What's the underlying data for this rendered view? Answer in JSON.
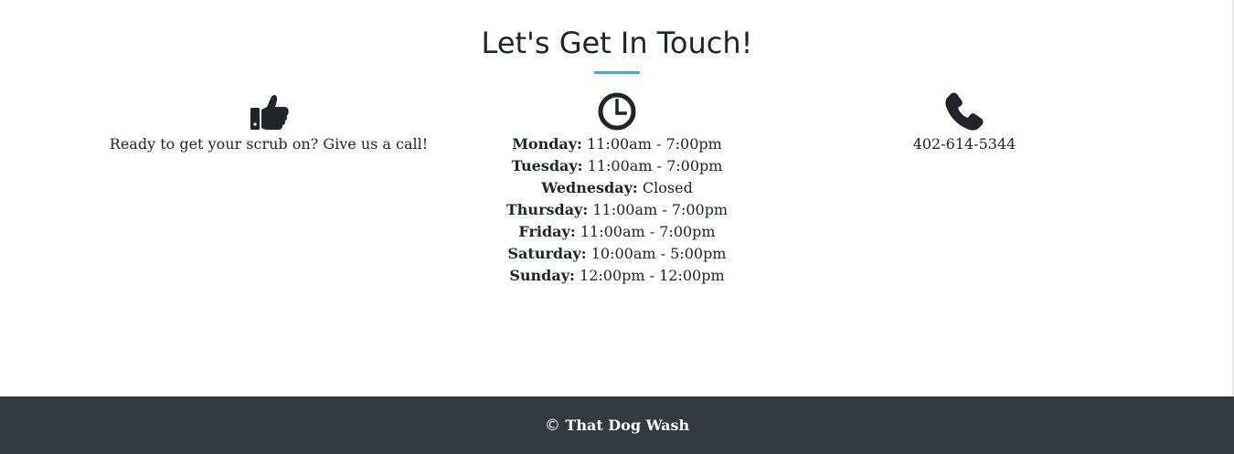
{
  "contact": {
    "heading": "Let's Get In Touch!",
    "accent_color": "#4aa8d8",
    "call": {
      "icon": "thumbs-up-icon",
      "text": "Ready to get your scrub on? Give us a call!"
    },
    "hours": {
      "icon": "clock-icon",
      "rows": [
        {
          "day": "Monday:",
          "time": "11:00am - 7:00pm"
        },
        {
          "day": "Tuesday:",
          "time": "11:00am - 7:00pm"
        },
        {
          "day": "Wednesday:",
          "time": "Closed"
        },
        {
          "day": "Thursday:",
          "time": "11:00am - 7:00pm"
        },
        {
          "day": "Friday:",
          "time": "11:00am - 7:00pm"
        },
        {
          "day": "Saturday:",
          "time": "10:00am - 5:00pm"
        },
        {
          "day": "Sunday:",
          "time": "12:00pm - 12:00pm"
        }
      ]
    },
    "phone": {
      "icon": "phone-icon",
      "number": "402-614-5344"
    }
  },
  "footer": {
    "copyright_symbol": "©",
    "text": "That Dog Wash",
    "background_color": "#343a42"
  }
}
